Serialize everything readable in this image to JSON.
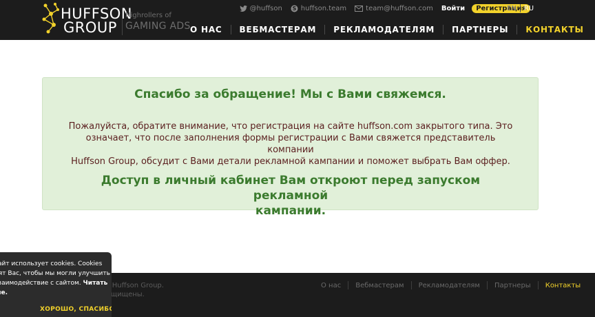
{
  "header": {
    "logo": {
      "line1": "HUFFSON",
      "line2": "GROUP"
    },
    "tagline": {
      "line1": "Highrollers of",
      "line2": "GAMING ADS"
    },
    "contacts": {
      "twitter": "@huffson",
      "skype": "huffson.team",
      "email": "team@huffson.com"
    },
    "login_label": "Войти",
    "register_label": "Регистрация",
    "languages": [
      "EN",
      "RU"
    ],
    "active_language": "RU",
    "nav": [
      {
        "label": "О НАС"
      },
      {
        "label": "ВЕБМАСТЕРАМ"
      },
      {
        "label": "РЕКЛАМОДАТЕЛЯМ"
      },
      {
        "label": "ПАРТНЕРЫ"
      },
      {
        "label": "КОНТАКТЫ"
      }
    ]
  },
  "message": {
    "title": "Спасибо за обращение! Мы с Вами свяжемся.",
    "line1": "Пожалуйста, обратите внимание, что регистрация на сайте huffson.com закрытого типа. Это",
    "line2": "означает, что после заполнения формы регистрации с Вами свяжется представитель компании",
    "line3": "Huffson Group, обсудит с Вами детали рекламной кампании и поможет выбрать Вам оффер.",
    "bottom_line1": "Доступ в личный кабинет Вам откроют перед запуском рекламной",
    "bottom_line2": "кампании."
  },
  "footer": {
    "copyright_line1": "0 © Huffson Group.",
    "copyright_line2": "а защищены.",
    "nav": [
      {
        "label": "О нас"
      },
      {
        "label": "Вебмастерам"
      },
      {
        "label": "Рекламодателям"
      },
      {
        "label": "Партнеры"
      },
      {
        "label": "Контакты"
      }
    ]
  },
  "cookie": {
    "line1": "сайт использует cookies. Cookies",
    "line2": "нят Вас, чтобы мы могли улучшить",
    "line3_text": "взаимодействие с сайтом. ",
    "line3_bold": "Читать",
    "line4_bold": "ше.",
    "accept_label": "ХОРОШО, СПАСИБО"
  },
  "colors": {
    "header_bg": "#1c1c1c",
    "accent": "#f2d22b",
    "success_bg": "#e1f0d9",
    "success_text": "#3b7b2e",
    "body_text": "#5a1e1e"
  }
}
